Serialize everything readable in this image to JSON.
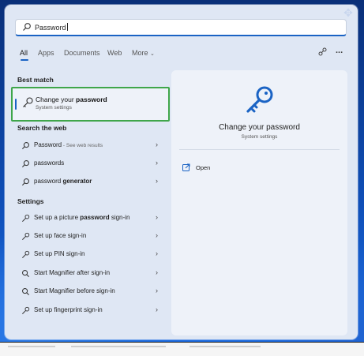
{
  "search": {
    "query": "Password"
  },
  "tabs": [
    {
      "label": "All"
    },
    {
      "label": "Apps"
    },
    {
      "label": "Documents"
    },
    {
      "label": "Web"
    },
    {
      "label": "More",
      "icon": "chevron-down-icon"
    }
  ],
  "top_actions": {
    "share_icon": "share-icon",
    "more_icon": "more-icon",
    "more_label": "..."
  },
  "sections": {
    "best_match": "Best match",
    "search_web": "Search the web",
    "settings": "Settings"
  },
  "best_match": {
    "title_prefix": "Change your ",
    "title_bold": "password",
    "subtitle": "System settings",
    "icon": "key-icon"
  },
  "web_results": [
    {
      "prefix": "Password",
      "bold": "",
      "hint": " - See web results"
    },
    {
      "prefix": "passwords",
      "bold": "",
      "hint": ""
    },
    {
      "prefix": "password ",
      "bold": "generator",
      "hint": ""
    }
  ],
  "settings_results": [
    {
      "prefix": "Set up a picture ",
      "bold": "password",
      "suffix": " sign-in",
      "icon": "key-icon"
    },
    {
      "prefix": "Set up face sign-in",
      "bold": "",
      "suffix": "",
      "icon": "key-icon"
    },
    {
      "prefix": "Set up PIN sign-in",
      "bold": "",
      "suffix": "",
      "icon": "key-icon"
    },
    {
      "prefix": "Start Magnifier after sign-in",
      "bold": "",
      "suffix": "",
      "icon": "magnifier-icon"
    },
    {
      "prefix": "Start Magnifier before sign-in",
      "bold": "",
      "suffix": "",
      "icon": "magnifier-icon"
    },
    {
      "prefix": "Set up fingerprint sign-in",
      "bold": "",
      "suffix": "",
      "icon": "key-icon"
    }
  ],
  "preview": {
    "title": "Change your password",
    "subtitle": "System settings",
    "open_label": "Open"
  },
  "colors": {
    "accent": "#1a63c4",
    "highlight_border": "#3fa64a"
  }
}
